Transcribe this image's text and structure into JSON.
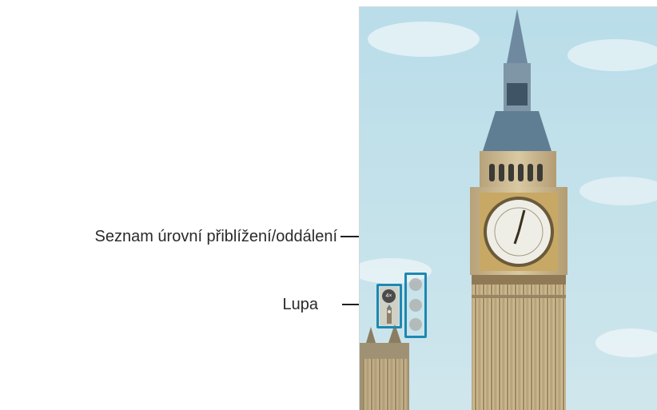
{
  "callouts": {
    "zoom_levels": "Seznam úrovní přiblížení/oddálení",
    "magnifier": "Lupa"
  },
  "magnifier": {
    "zoom_badge": "4×"
  },
  "zoom_list": {
    "dots": 3
  },
  "colors": {
    "highlight": "#1e88b0",
    "sky": "#bfe0ea",
    "stone": "#c9b58d"
  },
  "icons": [
    "magnifier-badge",
    "zoom-level-dot"
  ]
}
